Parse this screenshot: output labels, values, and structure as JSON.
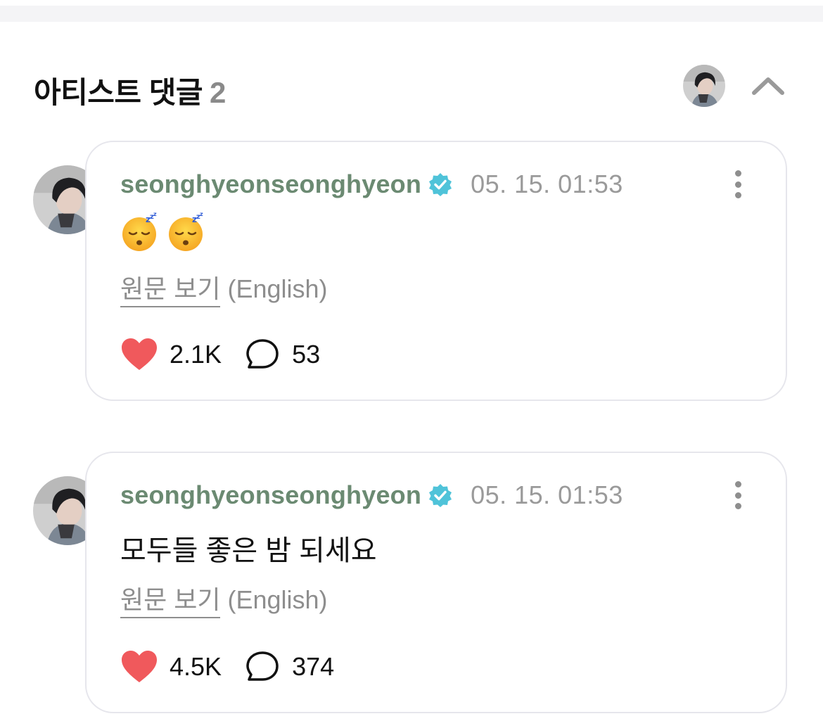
{
  "section": {
    "title": "아티스트 댓글",
    "count": "2"
  },
  "icons": {
    "collapse": "chevron-up-icon",
    "verified": "verified-badge-icon",
    "more": "more-vertical-icon",
    "like": "heart-icon",
    "reply": "speech-bubble-icon"
  },
  "colors": {
    "username": "#6b8a72",
    "verified": "#4fc3d9",
    "heart": "#f0595c",
    "border": "#e6e6ec"
  },
  "comments": [
    {
      "username": "seonghyeonseonghyeon",
      "timestamp": "05. 15. 01:53",
      "body_emojis": [
        "sleeping-face-emoji",
        "sleeping-face-emoji"
      ],
      "translate_label": "원문 보기",
      "translate_lang": "(English)",
      "likes": "2.1K",
      "replies": "53"
    },
    {
      "username": "seonghyeonseonghyeon",
      "timestamp": "05. 15. 01:53",
      "body": "모두들 좋은 밤 되세요",
      "translate_label": "원문 보기",
      "translate_lang": "(English)",
      "likes": "4.5K",
      "replies": "374"
    }
  ]
}
